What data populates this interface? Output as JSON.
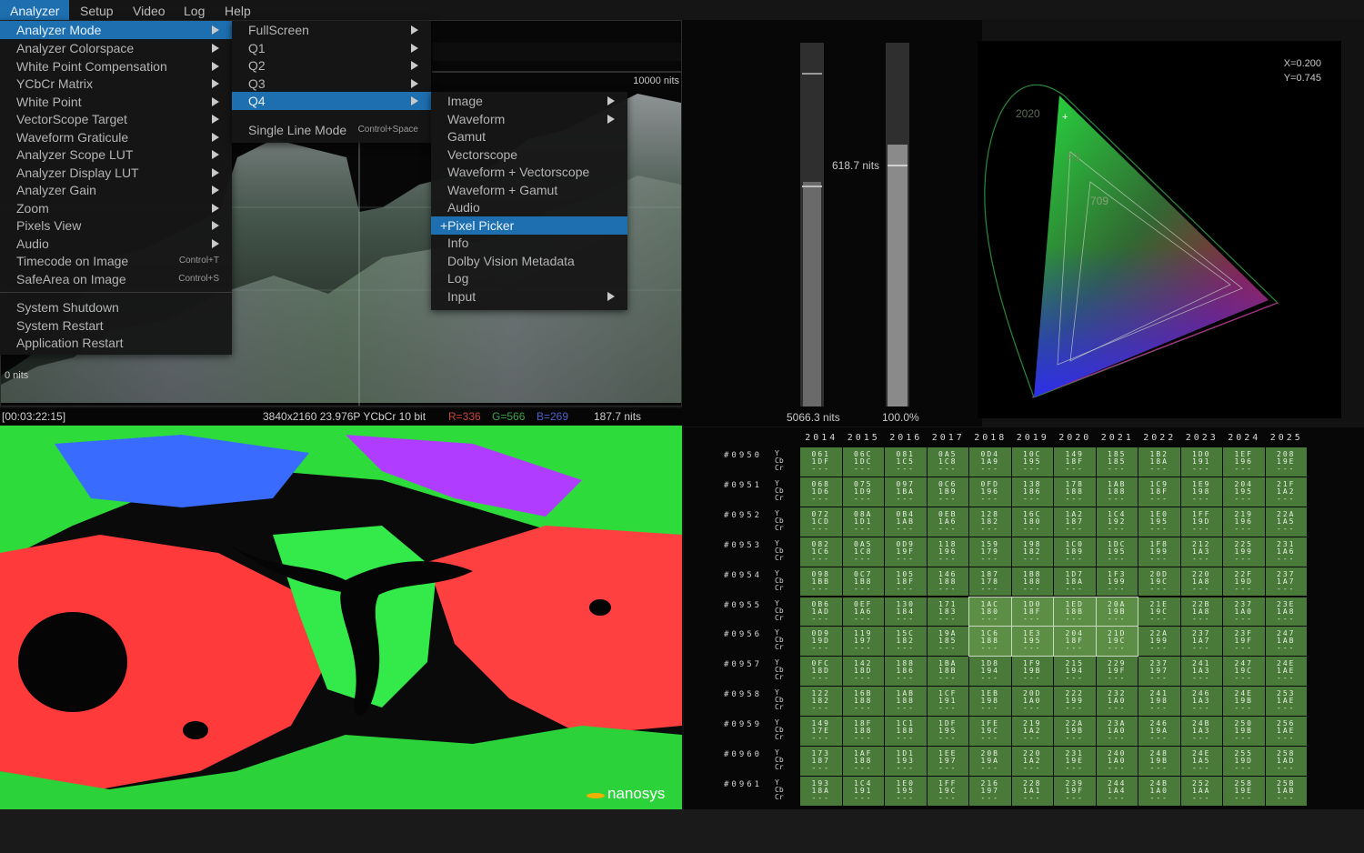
{
  "menubar": {
    "items": [
      "Analyzer",
      "Setup",
      "Video",
      "Log",
      "Help"
    ],
    "active": "Analyzer"
  },
  "analyzer_menu": {
    "items": [
      {
        "label": "Analyzer Mode",
        "submenu": true,
        "highlighted": true
      },
      {
        "label": "Analyzer Colorspace",
        "submenu": true
      },
      {
        "label": "White Point Compensation",
        "submenu": true
      },
      {
        "label": "YCbCr Matrix",
        "submenu": true
      },
      {
        "label": "White Point",
        "submenu": true
      },
      {
        "label": "VectorScope Target",
        "submenu": true
      },
      {
        "label": "Waveform Graticule",
        "submenu": true
      },
      {
        "label": "Analyzer Scope LUT",
        "submenu": true
      },
      {
        "label": "Analyzer Display LUT",
        "submenu": true
      },
      {
        "label": "Analyzer Gain",
        "submenu": true
      },
      {
        "label": "Zoom",
        "submenu": true
      },
      {
        "label": "Pixels View",
        "submenu": true
      },
      {
        "label": "Audio",
        "submenu": true
      },
      {
        "label": "Timecode on Image",
        "shortcut": "Control+T"
      },
      {
        "label": "SafeArea on Image",
        "shortcut": "Control+S"
      }
    ],
    "system_items": [
      "System Shutdown",
      "System Restart",
      "Application Restart"
    ]
  },
  "mode_menu": {
    "items": [
      {
        "label": "FullScreen",
        "submenu": true
      },
      {
        "label": "Q1",
        "submenu": true
      },
      {
        "label": "Q2",
        "submenu": true
      },
      {
        "label": "Q3",
        "submenu": true
      },
      {
        "label": "Q4",
        "submenu": true,
        "highlighted": true
      }
    ],
    "single_line": {
      "label": "Single Line Mode",
      "shortcut": "Control+Space"
    }
  },
  "q4_menu": {
    "items": [
      {
        "label": "Image",
        "submenu": true
      },
      {
        "label": "Waveform",
        "submenu": true
      },
      {
        "label": "Gamut"
      },
      {
        "label": "Vectorscope"
      },
      {
        "label": "Waveform + Vectorscope"
      },
      {
        "label": "Waveform + Gamut"
      },
      {
        "label": "Audio"
      },
      {
        "label": "+Pixel Picker",
        "highlighted": true
      },
      {
        "label": "Info"
      },
      {
        "label": "Dolby Vision Metadata"
      },
      {
        "label": "Log"
      },
      {
        "label": "Input",
        "submenu": true
      }
    ]
  },
  "waveform": {
    "top_label": "10000 nits",
    "bottom_label": "0 nits"
  },
  "status": {
    "timecode": "[00:03:22:15]",
    "format": "3840x2160 23.976P YCbCr 10 bit",
    "r": "R=336",
    "g": "G=566",
    "b": "B=269",
    "nits": "187.7 nits",
    "colors": {
      "r": "#c8443c",
      "g": "#3fa24a",
      "b": "#4b62c8"
    }
  },
  "meters": {
    "left_value_label": "618.7 nits",
    "left_bottom_label": "5066.3 nits",
    "right_bottom_label": "100.0%",
    "left_level": 0.618,
    "right_level": 0.72
  },
  "gamut": {
    "coords_x": "X=0.200",
    "coords_y": "Y=0.745",
    "labels": [
      "2020",
      "P3",
      "709"
    ]
  },
  "image": {
    "logo_text": "nanosys"
  },
  "pixel_grid": {
    "columns": [
      "2014",
      "2015",
      "2016",
      "2017",
      "2018",
      "2019",
      "2020",
      "2021",
      "2022",
      "2023",
      "2024",
      "2025"
    ],
    "channel_labels": [
      "Y",
      "Cb",
      "Cr"
    ],
    "placeholder": "---",
    "rows": [
      {
        "label": "#0950",
        "cells": [
          [
            "061",
            "1DF"
          ],
          [
            "06C",
            "1DC"
          ],
          [
            "081",
            "1C5"
          ],
          [
            "0A5",
            "1C8"
          ],
          [
            "0D4",
            "1A9"
          ],
          [
            "10C",
            "195"
          ],
          [
            "149",
            "18F"
          ],
          [
            "185",
            "185"
          ],
          [
            "1B2",
            "18A"
          ],
          [
            "1D0",
            "191"
          ],
          [
            "1EF",
            "196"
          ],
          [
            "208",
            "19E"
          ]
        ]
      },
      {
        "label": "#0951",
        "cells": [
          [
            "068",
            "1D6"
          ],
          [
            "075",
            "1D9"
          ],
          [
            "097",
            "1BA"
          ],
          [
            "0C6",
            "1B9"
          ],
          [
            "0FD",
            "196"
          ],
          [
            "138",
            "186"
          ],
          [
            "178",
            "188"
          ],
          [
            "1AB",
            "188"
          ],
          [
            "1C9",
            "18F"
          ],
          [
            "1E9",
            "198"
          ],
          [
            "204",
            "195"
          ],
          [
            "21F",
            "1A2"
          ]
        ]
      },
      {
        "label": "#0952",
        "cells": [
          [
            "072",
            "1CD"
          ],
          [
            "08A",
            "1D1"
          ],
          [
            "0B4",
            "1AB"
          ],
          [
            "0EB",
            "1A6"
          ],
          [
            "128",
            "182"
          ],
          [
            "16C",
            "180"
          ],
          [
            "1A2",
            "187"
          ],
          [
            "1C4",
            "192"
          ],
          [
            "1E0",
            "195"
          ],
          [
            "1FF",
            "19D"
          ],
          [
            "219",
            "196"
          ],
          [
            "22A",
            "1A5"
          ]
        ]
      },
      {
        "label": "#0953",
        "cells": [
          [
            "082",
            "1C6"
          ],
          [
            "0A5",
            "1C8"
          ],
          [
            "0D9",
            "19F"
          ],
          [
            "118",
            "196"
          ],
          [
            "159",
            "179"
          ],
          [
            "198",
            "182"
          ],
          [
            "1C0",
            "189"
          ],
          [
            "1DC",
            "195"
          ],
          [
            "1F8",
            "199"
          ],
          [
            "212",
            "1A3"
          ],
          [
            "225",
            "199"
          ],
          [
            "231",
            "1A6"
          ]
        ]
      },
      {
        "label": "#0954",
        "cells": [
          [
            "098",
            "1BB"
          ],
          [
            "0C7",
            "1B8"
          ],
          [
            "105",
            "18F"
          ],
          [
            "146",
            "188"
          ],
          [
            "187",
            "178"
          ],
          [
            "1B8",
            "188"
          ],
          [
            "1D7",
            "18A"
          ],
          [
            "1F3",
            "199"
          ],
          [
            "20D",
            "19C"
          ],
          [
            "220",
            "1A8"
          ],
          [
            "22F",
            "19D"
          ],
          [
            "237",
            "1A7"
          ]
        ]
      },
      {
        "label": "#0955",
        "cells": [
          [
            "0B6",
            "1AD"
          ],
          [
            "0EF",
            "1A6"
          ],
          [
            "130",
            "184"
          ],
          [
            "171",
            "183"
          ],
          [
            "1AC",
            "180"
          ],
          [
            "1D0",
            "18F"
          ],
          [
            "1ED",
            "18B"
          ],
          [
            "20A",
            "19B"
          ],
          [
            "21E",
            "19C"
          ],
          [
            "22B",
            "1A8"
          ],
          [
            "237",
            "1A0"
          ],
          [
            "23E",
            "1A8"
          ]
        ]
      },
      {
        "label": "#0956",
        "cells": [
          [
            "0D9",
            "19D"
          ],
          [
            "119",
            "197"
          ],
          [
            "15C",
            "182"
          ],
          [
            "19A",
            "185"
          ],
          [
            "1C6",
            "188"
          ],
          [
            "1E3",
            "195"
          ],
          [
            "204",
            "18F"
          ],
          [
            "21D",
            "19C"
          ],
          [
            "22A",
            "199"
          ],
          [
            "237",
            "1A7"
          ],
          [
            "23F",
            "19F"
          ],
          [
            "247",
            "1AB"
          ]
        ]
      },
      {
        "label": "#0957",
        "cells": [
          [
            "0FC",
            "18D"
          ],
          [
            "142",
            "18D"
          ],
          [
            "188",
            "186"
          ],
          [
            "1BA",
            "18B"
          ],
          [
            "1D8",
            "194"
          ],
          [
            "1F9",
            "19B"
          ],
          [
            "215",
            "194"
          ],
          [
            "229",
            "19F"
          ],
          [
            "237",
            "197"
          ],
          [
            "241",
            "1A3"
          ],
          [
            "247",
            "19C"
          ],
          [
            "24E",
            "1AE"
          ]
        ]
      },
      {
        "label": "#0958",
        "cells": [
          [
            "122",
            "182"
          ],
          [
            "16B",
            "188"
          ],
          [
            "1AB",
            "188"
          ],
          [
            "1CF",
            "191"
          ],
          [
            "1EB",
            "198"
          ],
          [
            "20D",
            "1A0"
          ],
          [
            "222",
            "199"
          ],
          [
            "232",
            "1A0"
          ],
          [
            "241",
            "198"
          ],
          [
            "246",
            "1A3"
          ],
          [
            "24E",
            "19B"
          ],
          [
            "253",
            "1AE"
          ]
        ]
      },
      {
        "label": "#0959",
        "cells": [
          [
            "149",
            "17E"
          ],
          [
            "18F",
            "188"
          ],
          [
            "1C1",
            "188"
          ],
          [
            "1DF",
            "195"
          ],
          [
            "1FE",
            "19C"
          ],
          [
            "219",
            "1A2"
          ],
          [
            "22A",
            "19B"
          ],
          [
            "23A",
            "1A0"
          ],
          [
            "246",
            "19A"
          ],
          [
            "24B",
            "1A3"
          ],
          [
            "250",
            "19B"
          ],
          [
            "256",
            "1AE"
          ]
        ]
      },
      {
        "label": "#0960",
        "cells": [
          [
            "173",
            "187"
          ],
          [
            "1AF",
            "188"
          ],
          [
            "1D1",
            "193"
          ],
          [
            "1EE",
            "197"
          ],
          [
            "20B",
            "19A"
          ],
          [
            "220",
            "1A2"
          ],
          [
            "231",
            "19E"
          ],
          [
            "240",
            "1A0"
          ],
          [
            "248",
            "19B"
          ],
          [
            "24E",
            "1A5"
          ],
          [
            "255",
            "19D"
          ],
          [
            "258",
            "1AD"
          ]
        ]
      },
      {
        "label": "#0961",
        "cells": [
          [
            "193",
            "18A"
          ],
          [
            "1C4",
            "191"
          ],
          [
            "1E0",
            "195"
          ],
          [
            "1FF",
            "19C"
          ],
          [
            "216",
            "197"
          ],
          [
            "228",
            "1A1"
          ],
          [
            "239",
            "19F"
          ],
          [
            "244",
            "1A4"
          ],
          [
            "24B",
            "1A0"
          ],
          [
            "252",
            "1AA"
          ],
          [
            "258",
            "19E"
          ],
          [
            "25B",
            "1AB"
          ]
        ]
      }
    ],
    "highlight": {
      "rows": [
        5,
        6
      ],
      "cols": [
        4,
        7
      ]
    }
  }
}
